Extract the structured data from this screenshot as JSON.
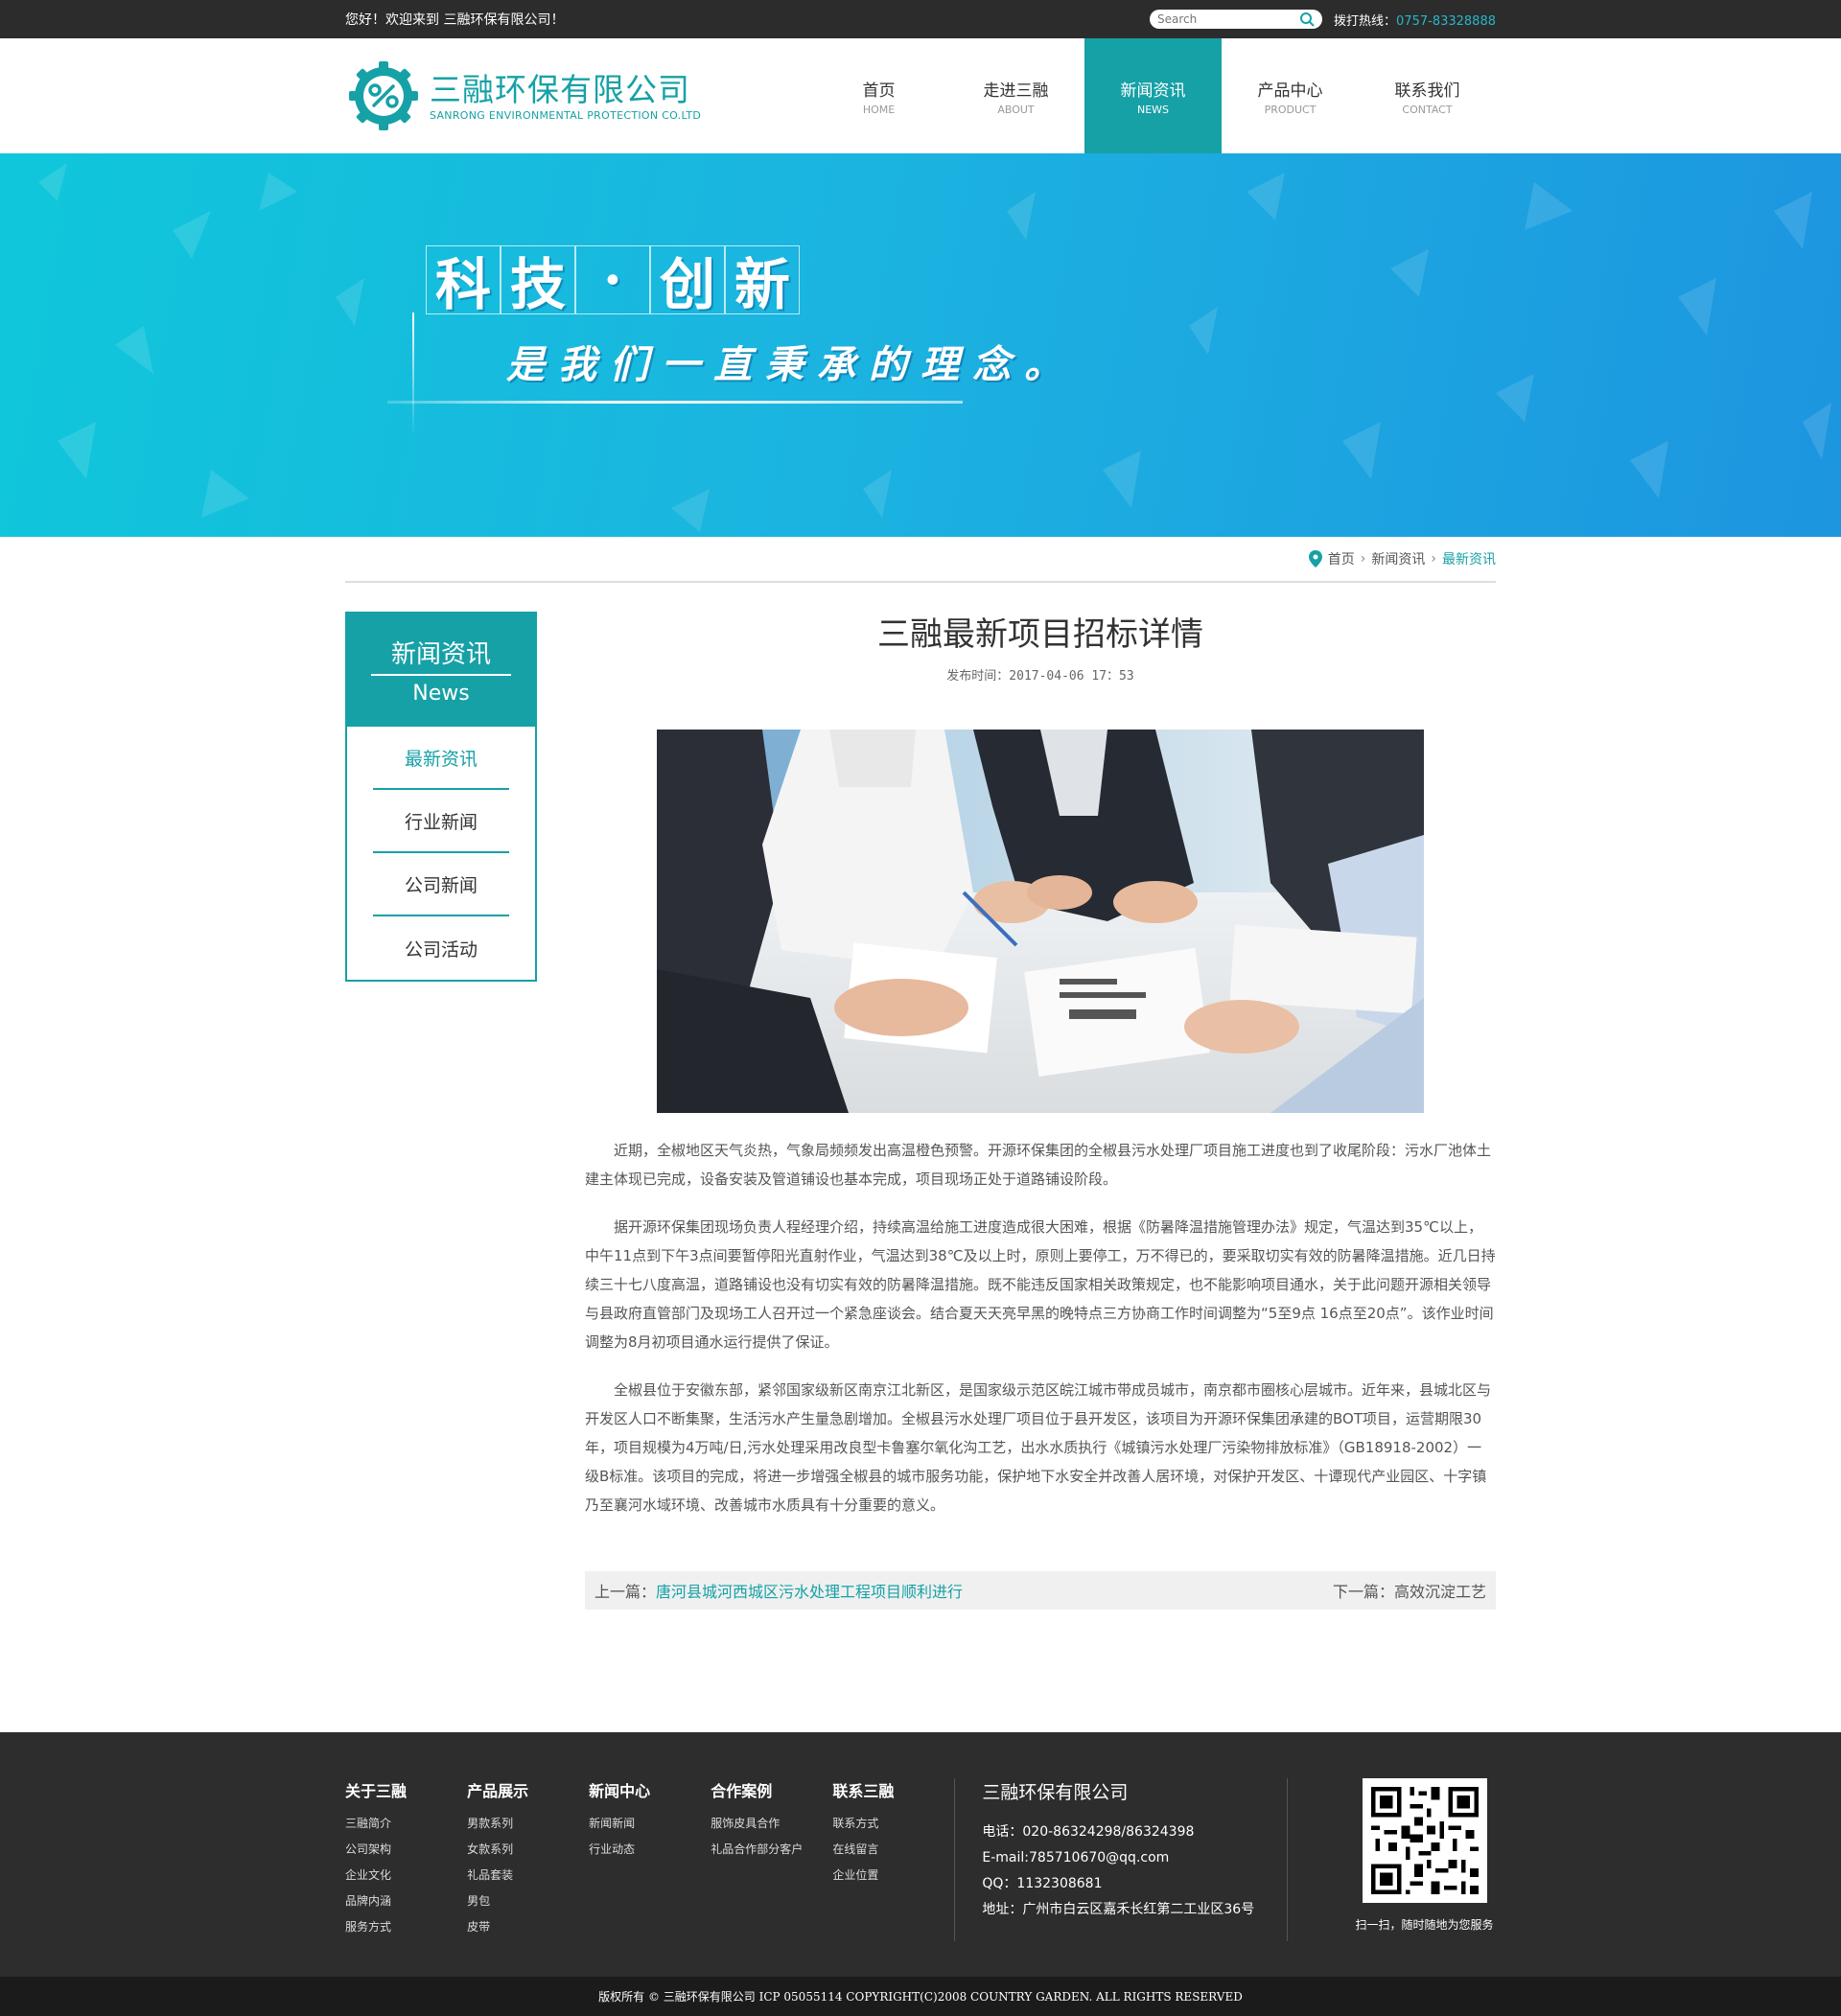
{
  "topbar": {
    "welcome": "您好！欢迎来到 三融环保有限公司！",
    "search_placeholder": "Search",
    "hotline_label": "拨打热线：",
    "hotline_number": "0757-83328888"
  },
  "logo": {
    "cn": "三融环保有限公司",
    "en": "SANRONG ENVIRONMENTAL PROTECTION CO.LTD"
  },
  "nav": [
    {
      "cn": "首页",
      "en": "HOME"
    },
    {
      "cn": "走进三融",
      "en": "ABOUT"
    },
    {
      "cn": "新闻资讯",
      "en": "NEWS"
    },
    {
      "cn": "产品中心",
      "en": "PRODUCT"
    },
    {
      "cn": "联系我们",
      "en": "CONTACT"
    }
  ],
  "banner": {
    "chars": [
      "科",
      "技",
      "·",
      "创",
      "新"
    ],
    "subtitle": "是我们一直秉承的理念。"
  },
  "breadcrumb": [
    "首页",
    "新闻资讯",
    "最新资讯"
  ],
  "sidebar": {
    "title_cn": "新闻资讯",
    "title_en": "News",
    "items": [
      "最新资讯",
      "行业新闻",
      "公司新闻",
      "公司活动"
    ]
  },
  "article": {
    "title": "三融最新项目招标详情",
    "date": "发布时间：2017-04-06 17：53",
    "paragraphs": [
      "近期，全椒地区天气炎热，气象局频频发出高温橙色预警。开源环保集团的全椒县污水处理厂项目施工进度也到了收尾阶段：污水厂池体土建主体现已完成，设备安装及管道铺设也基本完成，项目现场正处于道路铺设阶段。",
      "据开源环保集团现场负责人程经理介绍，持续高温给施工进度造成很大困难，根据《防暑降温措施管理办法》规定，气温达到35℃以上，中午11点到下午3点间要暂停阳光直射作业，气温达到38℃及以上时，原则上要停工，万不得已的，要采取切实有效的防暑降温措施。近几日持续三十七八度高温，道路铺设也没有切实有效的防暑降温措施。既不能违反国家相关政策规定，也不能影响项目通水，关于此问题开源相关领导与县政府直管部门及现场工人召开过一个紧急座谈会。结合夏天天亮早黑的晚特点三方协商工作时间调整为“5至9点 16点至20点”。该作业时间调整为8月初项目通水运行提供了保证。",
      "全椒县位于安徽东部，紧邻国家级新区南京江北新区，是国家级示范区皖江城市带成员城市，南京都市圈核心层城市。近年来，县城北区与开发区人口不断集聚，生活污水产生量急剧增加。全椒县污水处理厂项目位于县开发区，该项目为开源环保集团承建的BOT项目，运营期限30年，项目规模为4万吨/日,污水处理采用改良型卡鲁塞尔氧化沟工艺，出水水质执行《城镇污水处理厂污染物排放标准》（GB18918-2002）一级B标准。该项目的完成，将进一步增强全椒县的城市服务功能，保护地下水安全并改善人居环境，对保护开发区、十谭现代产业园区、十字镇乃至襄河水域环境、改善城市水质具有十分重要的意义。"
    ],
    "prev_label": "上一篇：",
    "prev_title": "唐河县城河西城区污水处理工程项目顺利进行",
    "next_label": "下一篇：",
    "next_title": "高效沉淀工艺"
  },
  "footer": {
    "columns": [
      {
        "title": "关于三融",
        "links": [
          "三融简介",
          "公司架构",
          "企业文化",
          "品牌内涵",
          "服务方式"
        ]
      },
      {
        "title": "产品展示",
        "links": [
          "男款系列",
          "女款系列",
          "礼品套装",
          "男包",
          "皮带"
        ]
      },
      {
        "title": "新闻中心",
        "links": [
          "新闻新闻",
          "行业动态"
        ]
      },
      {
        "title": "合作案例",
        "links": [
          "服饰皮具合作",
          "礼品合作部分客户"
        ]
      },
      {
        "title": "联系三融",
        "links": [
          "联系方式",
          "在线留言",
          "企业位置"
        ]
      }
    ],
    "company": "三融环保有限公司",
    "phone": "电话：020-86324298/86324398",
    "email": "E-mail:785710670@qq.com",
    "qq": "QQ：1132308681",
    "address": "地址：广州市白云区嘉禾长红第二工业区36号",
    "qr_caption": "扫一扫，随时随地为您服务",
    "copyright": "版权所有 © 三融环保有限公司 ICP 05055114 COPYRIGHT(C)2008 COUNTRY GARDEN. ALL RIGHTS RESERVED"
  },
  "colors": {
    "accent": "#16a1a6",
    "topbar": "#2c2c2c",
    "footer": "#2d2d2d"
  }
}
